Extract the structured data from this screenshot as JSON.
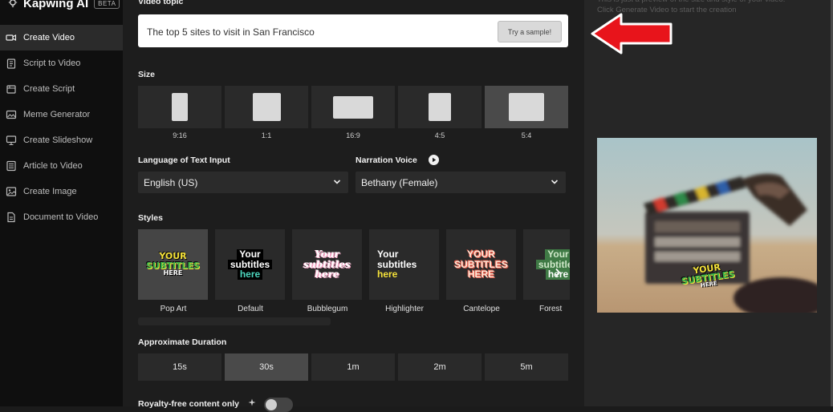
{
  "app": {
    "name": "Kapwing AI",
    "badge": "BETA"
  },
  "sidebar": {
    "items": [
      {
        "label": "Create Video",
        "icon": "video-camera-icon",
        "active": true
      },
      {
        "label": "Script to Video",
        "icon": "clipboard-icon"
      },
      {
        "label": "Create Script",
        "icon": "script-icon"
      },
      {
        "label": "Meme Generator",
        "icon": "image-frame-icon"
      },
      {
        "label": "Create Slideshow",
        "icon": "slideshow-icon"
      },
      {
        "label": "Article to Video",
        "icon": "article-icon"
      },
      {
        "label": "Create Image",
        "icon": "image-icon"
      },
      {
        "label": "Document to Video",
        "icon": "document-icon"
      }
    ]
  },
  "form": {
    "topic_label": "Video topic",
    "topic_value": "The top 5 sites to visit in San Francisco",
    "sample_button": "Try a sample!",
    "size_label": "Size",
    "sizes": [
      "9:16",
      "1:1",
      "16:9",
      "4:5",
      "5:4"
    ],
    "size_selected": "5:4",
    "language_label": "Language of Text Input",
    "language_value": "English (US)",
    "voice_label": "Narration Voice",
    "voice_value": "Bethany (Female)",
    "styles_label": "Styles",
    "styles": [
      {
        "name": "Pop Art",
        "line1": "YOUR",
        "line2": "SUBTITLES",
        "line3": "HERE"
      },
      {
        "name": "Default",
        "line1": "Your",
        "line2": "subtitles",
        "line3": "here"
      },
      {
        "name": "Bubblegum",
        "line1": "Your",
        "line2": "subtitles",
        "line3": "here"
      },
      {
        "name": "Highlighter",
        "line1": "Your",
        "line2": "subtitles",
        "line3": "here"
      },
      {
        "name": "Cantelope",
        "line1": "YOUR",
        "line2": "SUBTITLES",
        "line3": "HERE"
      },
      {
        "name": "Forest",
        "line1": "Your",
        "line2": "subtitles",
        "line3": "here"
      }
    ],
    "duration_label": "Approximate Duration",
    "durations": [
      "15s",
      "30s",
      "1m",
      "2m",
      "5m"
    ],
    "duration_selected": "30s",
    "royalty_label": "Royalty-free content only"
  },
  "preview": {
    "hint": "This is just a preview of the size and style of your video. Click Generate Video to start the creation",
    "subtitle_line1": "YOUR",
    "subtitle_line2": "SUBTITLES",
    "subtitle_line3": "HERE"
  },
  "colors": {
    "arrow": "#e8141b",
    "popart_yellow": "#f5e23a",
    "popart_green": "#3bb34a",
    "highlight": "#4dd8c0",
    "bubblegum": "#f7a8c8"
  }
}
